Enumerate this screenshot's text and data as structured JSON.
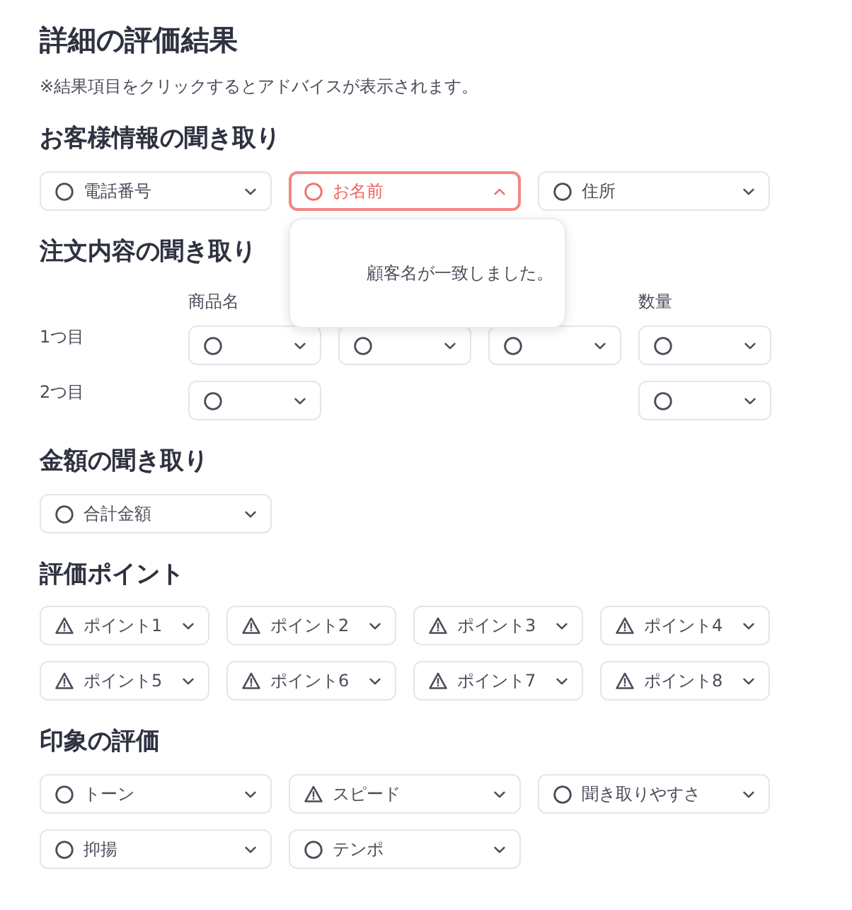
{
  "title": "詳細の評価結果",
  "note": "※結果項目をクリックするとアドバイスが表示されます。",
  "sections": [
    {
      "kind": "select_list",
      "heading": "お客様情報の聞き取り",
      "items": [
        {
          "label": "電話番号",
          "kind": "ok",
          "expanded": false
        },
        {
          "label": "お名前",
          "kind": "ok",
          "expanded": true,
          "advice": "顧客名が一致しました。"
        },
        {
          "label": "住所",
          "kind": "ok",
          "expanded": false
        }
      ]
    },
    {
      "kind": "order_table",
      "heading": "注文内容の聞き取り",
      "columns": [
        "商品名",
        null,
        null,
        "数量"
      ],
      "rows": [
        {
          "label": "1つ目",
          "cells": [
            {
              "kind": "ok",
              "expanded": false
            },
            {
              "kind": "ok",
              "expanded": false
            },
            {
              "kind": "ok",
              "expanded": false
            },
            {
              "kind": "ok",
              "expanded": false
            }
          ]
        },
        {
          "label": "2つ目",
          "cells": [
            {
              "kind": "ok",
              "expanded": false
            },
            null,
            null,
            {
              "kind": "ok",
              "expanded": false
            }
          ]
        }
      ]
    },
    {
      "kind": "select_list",
      "heading": "金額の聞き取り",
      "items": [
        {
          "label": "合計金額",
          "kind": "ok",
          "expanded": false
        }
      ]
    },
    {
      "kind": "point_grid",
      "heading": "評価ポイント",
      "items": [
        {
          "label": "ポイント1",
          "kind": "warning",
          "expanded": false
        },
        {
          "label": "ポイント2",
          "kind": "warning",
          "expanded": false
        },
        {
          "label": "ポイント3",
          "kind": "warning",
          "expanded": false
        },
        {
          "label": "ポイント4",
          "kind": "warning",
          "expanded": false
        },
        {
          "label": "ポイント5",
          "kind": "warning",
          "expanded": false
        },
        {
          "label": "ポイント6",
          "kind": "warning",
          "expanded": false
        },
        {
          "label": "ポイント7",
          "kind": "warning",
          "expanded": false
        },
        {
          "label": "ポイント8",
          "kind": "warning",
          "expanded": false
        }
      ]
    },
    {
      "kind": "select_list",
      "heading": "印象の評価",
      "items": [
        {
          "label": "トーン",
          "kind": "ok",
          "expanded": false
        },
        {
          "label": "スピード",
          "kind": "warning",
          "expanded": false
        },
        {
          "label": "聞き取りやすさ",
          "kind": "ok",
          "expanded": false
        },
        {
          "label": "抑揚",
          "kind": "ok",
          "expanded": false
        },
        {
          "label": "テンポ",
          "kind": "ok",
          "expanded": false
        }
      ]
    }
  ]
}
